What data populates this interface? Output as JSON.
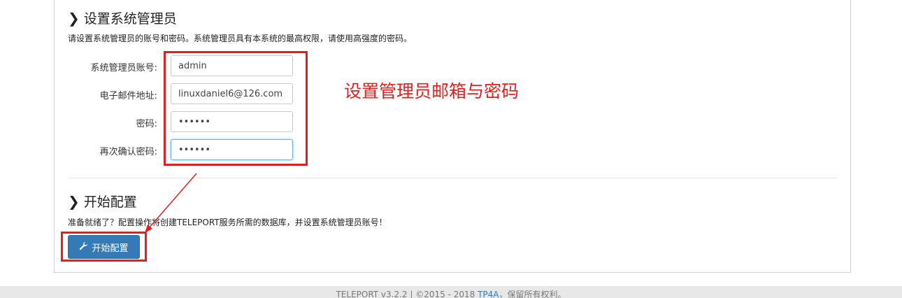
{
  "admin_section": {
    "title": "设置系统管理员",
    "description": "请设置系统管理员的账号和密码。系统管理员具有本系统的最高权限，请使用高强度的密码。",
    "fields": [
      {
        "label": "系统管理员账号:",
        "value": "admin"
      },
      {
        "label": "电子邮件地址:",
        "value": "linuxdaniel6@126.com"
      },
      {
        "label": "密码:",
        "value": "••••••"
      },
      {
        "label": "再次确认密码:",
        "value": "••••••"
      }
    ]
  },
  "annotation": {
    "text": "设置管理员邮箱与密码",
    "color": "#e02020"
  },
  "start_section": {
    "title": "开始配置",
    "description": "准备就绪了？配置操作将创建TELEPORT服务所需的数据库，并设置系统管理员账号！",
    "button_label": "开始配置",
    "button_icon": "wrench-icon"
  },
  "footer": {
    "text_prefix": "TELEPORT v3.2.2 | ©2015 - 2018 ",
    "link_text": "TP4A",
    "text_suffix": "，保留所有权利。"
  },
  "colors": {
    "primary": "#337ab7",
    "annotation_red": "#e02020"
  }
}
